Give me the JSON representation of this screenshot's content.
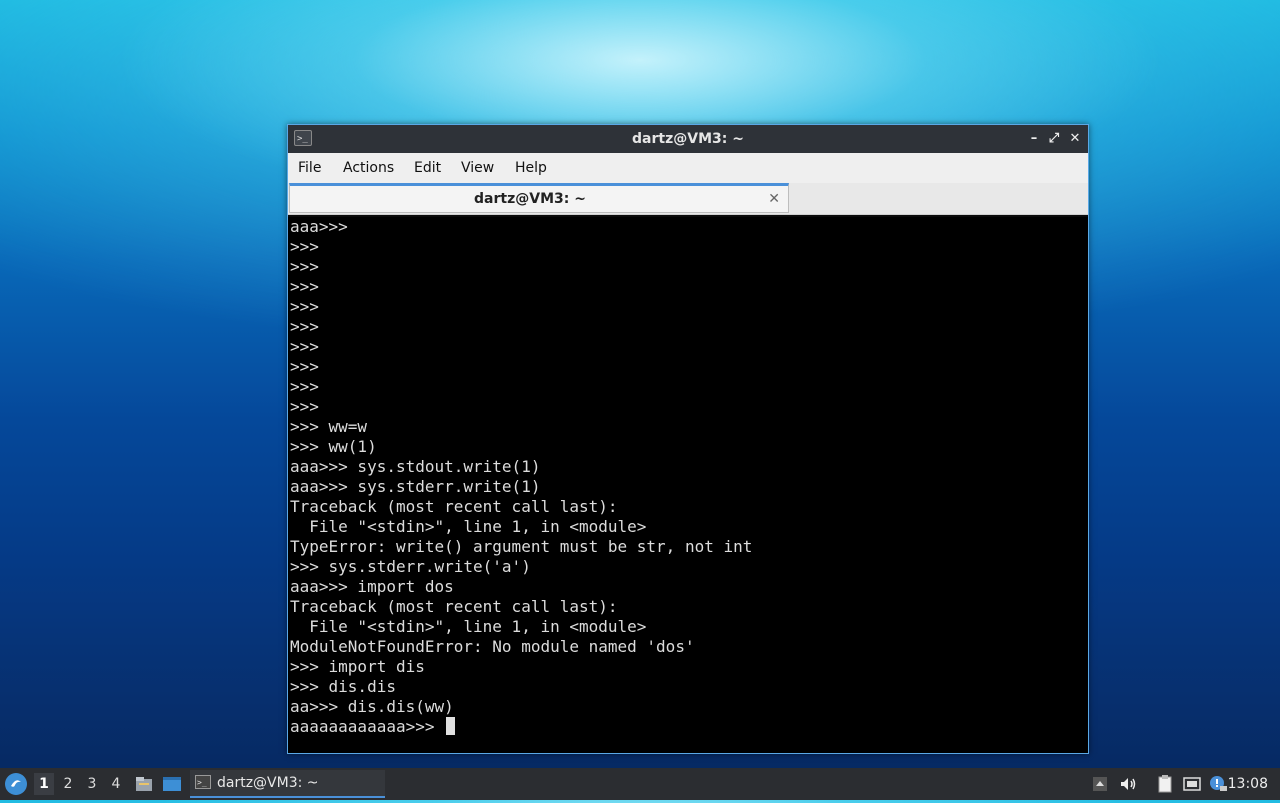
{
  "window": {
    "title": "dartz@VM3: ~",
    "app_icon_text": ">_",
    "controls": {
      "minimize": "–",
      "maximize": "⤢",
      "close": "✕"
    }
  },
  "menu": {
    "items": [
      "File",
      "Actions",
      "Edit",
      "View",
      "Help"
    ]
  },
  "tab": {
    "label": "dartz@VM3: ~",
    "close": "✕"
  },
  "terminal": {
    "lines": [
      "aaa>>>",
      ">>>",
      ">>>",
      ">>>",
      ">>>",
      ">>>",
      ">>>",
      ">>>",
      ">>>",
      ">>>",
      ">>> ww=w",
      ">>> ww(1)",
      "aaa>>> sys.stdout.write(1)",
      "aaa>>> sys.stderr.write(1)",
      "Traceback (most recent call last):",
      "  File \"<stdin>\", line 1, in <module>",
      "TypeError: write() argument must be str, not int",
      ">>> sys.stderr.write('a')",
      "aaa>>> import dos",
      "Traceback (most recent call last):",
      "  File \"<stdin>\", line 1, in <module>",
      "ModuleNotFoundError: No module named 'dos'",
      ">>> import dis",
      ">>> dis.dis",
      "aa>>> dis.dis(ww)"
    ],
    "prompt_line": "aaaaaaaaaaaa>>> "
  },
  "taskbar": {
    "workspaces": [
      "1",
      "2",
      "3",
      "4"
    ],
    "active_workspace": "1",
    "task_label": "dartz@VM3: ~",
    "clock": "13:08",
    "icons": {
      "start": "start-menu-icon",
      "files": "file-manager-icon",
      "desktop": "show-desktop-icon",
      "tray_up": "tray-expand-icon",
      "volume": "volume-icon",
      "clipboard": "clipboard-icon",
      "network": "network-icon",
      "updates": "notification-icon"
    }
  }
}
